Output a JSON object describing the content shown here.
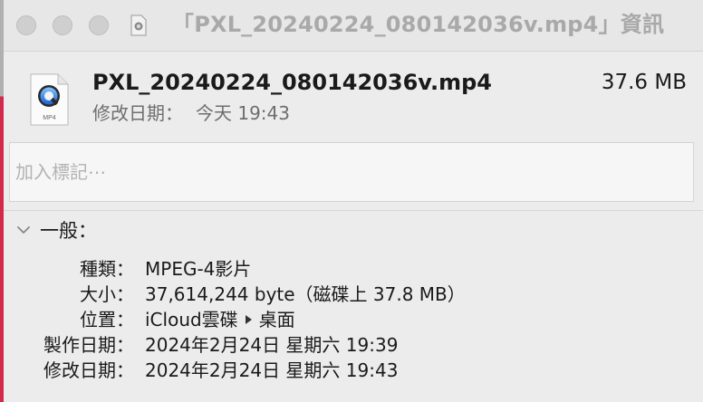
{
  "window": {
    "title": "「PXL_20240224_080142036v.mp4」資訊"
  },
  "header": {
    "file_name": "PXL_20240224_080142036v.mp4",
    "file_size": "37.6 MB",
    "modified_label": "修改日期：",
    "modified_value": "今天 19:43",
    "file_icon": {
      "name": "quicktime-mp4-icon",
      "badge": "MP4"
    }
  },
  "tags": {
    "placeholder": "加入標記⋯"
  },
  "general": {
    "title": "一般：",
    "rows": [
      {
        "label": "種類：",
        "value": "MPEG-4影片"
      },
      {
        "label": "大小：",
        "value": "37,614,244 byte（磁碟上 37.8 MB）"
      },
      {
        "label": "位置：",
        "path": [
          "iCloud雲碟",
          "桌面"
        ]
      },
      {
        "label": "製作日期：",
        "value": "2024年2月24日 星期六 19:39"
      },
      {
        "label": "修改日期：",
        "value": "2024年2月24日 星期六 19:43"
      }
    ]
  },
  "colors": {
    "title_text": "#a9a9a9",
    "accent_edge": "#d22a4a"
  }
}
